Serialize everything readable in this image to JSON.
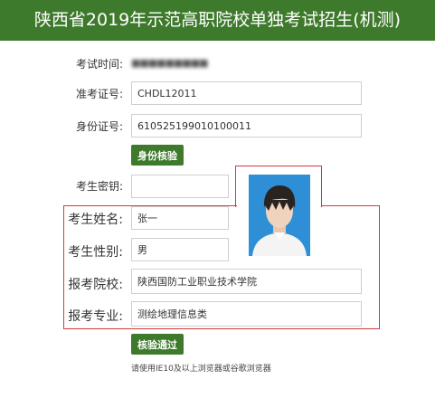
{
  "header": {
    "title": "陕西省2019年示范高职院校单独考试招生(机测)"
  },
  "form": {
    "exam_time": {
      "label": "考试时间:",
      "value": "■■■■■■■■■"
    },
    "admission_number": {
      "label": "准考证号:",
      "value": "CHDL12011"
    },
    "id_number": {
      "label": "身份证号:",
      "value": "610525199010100011"
    },
    "verify_identity_button": "身份核验",
    "password": {
      "label": "考生密钥:",
      "value": ""
    },
    "name": {
      "label": "考生姓名:",
      "value": "张一"
    },
    "gender": {
      "label": "考生性别:",
      "value": "男"
    },
    "school": {
      "label": "报考院校:",
      "value": "陕西国防工业职业技术学院"
    },
    "major": {
      "label": "报考专业:",
      "value": "测绘地理信息类"
    },
    "verify_pass_button": "核验通过"
  },
  "footer_note": "请使用IE10及以上浏览器或谷歌浏览器",
  "colors": {
    "header_bg": "#3e7a2c",
    "button_bg": "#3e7a2c",
    "highlight_border": "#d23a3a"
  },
  "icons": {
    "photo": "candidate-photo"
  }
}
